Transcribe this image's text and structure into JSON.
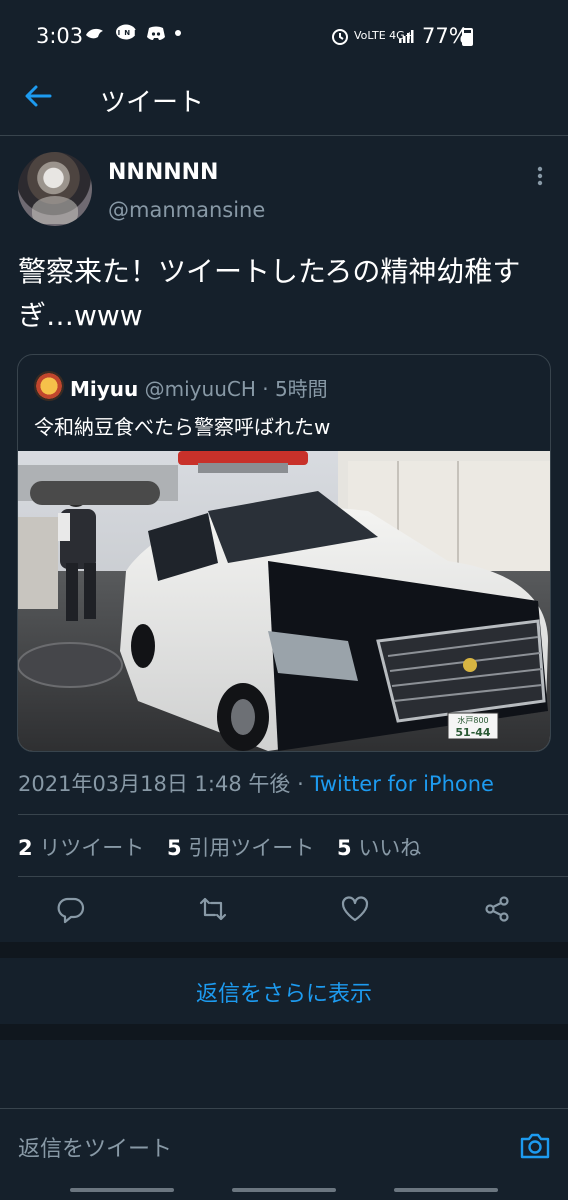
{
  "status_bar": {
    "time": "3:03",
    "notif_icons": [
      "shrimp-icon",
      "line-icon",
      "discord-icon",
      "dot-icon"
    ],
    "network_label": "VoLTE 4G+",
    "battery": "77%"
  },
  "header": {
    "title": "ツイート",
    "back_icon": "back-arrow-icon",
    "accent": "#1d9bf0"
  },
  "tweet": {
    "display_name": "NNNNNN",
    "handle": "@manmansine",
    "text": "警察来た！ツイートしたろの精神幼稚すぎ…www",
    "quote": {
      "name": "Miyuu",
      "handle": "@miyuuCH",
      "separator": "·",
      "time": "5時間",
      "text": "令和納豆食べたら警察呼ばれたw",
      "photo_plate_text": "水戸 800\nさ 51-44"
    },
    "meta": {
      "datetime": "2021年03月18日 1:48 午後",
      "separator": "·",
      "source": "Twitter for iPhone"
    },
    "stats": {
      "retweets_count": "2",
      "retweets_label": "リツイート",
      "quotes_count": "5",
      "quotes_label": "引用ツイート",
      "likes_count": "5",
      "likes_label": "いいね"
    },
    "actions": [
      "reply-icon",
      "retweet-icon",
      "like-icon",
      "share-icon"
    ]
  },
  "more_replies": "返信をさらに表示",
  "reply_bar": {
    "placeholder": "返信をツイート",
    "camera_icon": "camera-icon"
  },
  "colors": {
    "background": "#15202b",
    "secondary_text": "#8899a6",
    "border": "#38444d"
  }
}
